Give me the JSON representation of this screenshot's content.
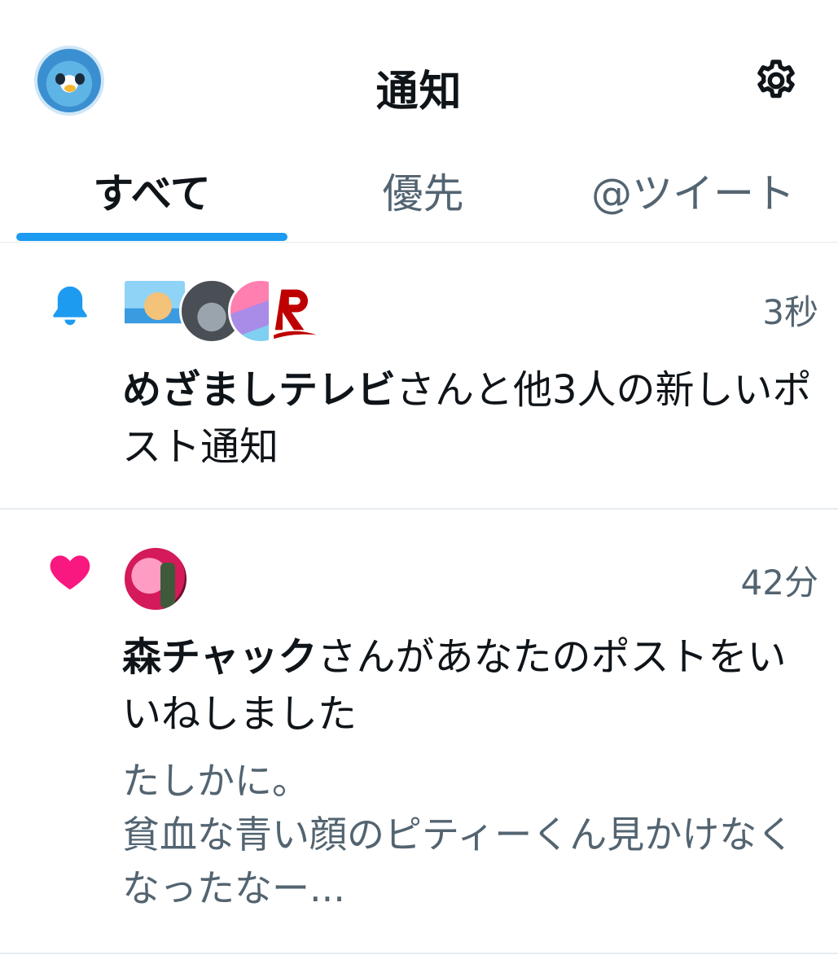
{
  "header": {
    "title": "通知"
  },
  "tabs": [
    {
      "label": "すべて",
      "active": true
    },
    {
      "label": "優先",
      "active": false
    },
    {
      "label": "@ツイート",
      "active": false
    }
  ],
  "colors": {
    "accent": "#1d9bf0",
    "like": "#f91880",
    "secondary_text": "#536471"
  },
  "notifications": [
    {
      "type_icon": "bell-icon",
      "timestamp": "3秒",
      "name": "めざましテレビ",
      "text": "さんと他3人の新しいポスト通知"
    },
    {
      "type_icon": "heart-icon",
      "timestamp": "42分",
      "name": "森チャック",
      "text": "さんがあなたのポストをいいねしました",
      "preview": "たしかに。\n貧血な青い顔のピティーくん見かけなくなったなー..."
    }
  ]
}
